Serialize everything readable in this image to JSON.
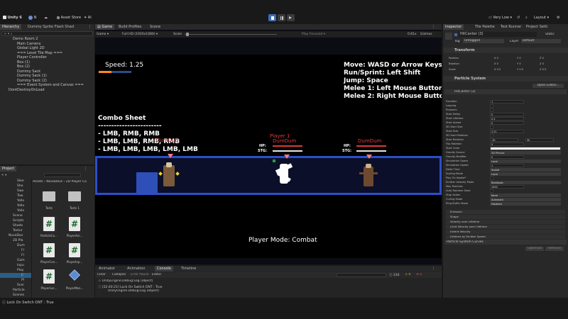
{
  "colors": {
    "accent": "#3d6db5",
    "hp_bar": "#d83a3a",
    "stg_bar": "#e8e8e8",
    "enemy_name": "#e23b3b"
  },
  "toolbar": {
    "unity_label": "Unity 6",
    "account": "N",
    "asset_store": "Asset Store",
    "ai": "AI",
    "quality": "Very Low",
    "layout": "Layout"
  },
  "tabs": {
    "hierarchy": "Hierarchy",
    "dummy": "Dummy Sprite Flash Shad",
    "game": "Game",
    "build_profiles": "Build Profiles",
    "scene": "Scene",
    "inspector": "Inspector",
    "tile_palette": "Tile Palette",
    "test_runner": "Test Runner",
    "project_settings": "Project Setti"
  },
  "hierarchy": {
    "items": [
      "Demo Room 2",
      "Main Camera",
      "Global Light 2D",
      "=== Level Tile Map ===",
      "Player Controller",
      "Box (1)",
      "Box (2)",
      "Dummy Sack",
      "Dummy Sack (1)",
      "Dummy Sack (2)",
      "=== Event System and Canvas ===",
      "DontDestroyOnLoad"
    ]
  },
  "project": {
    "tab": "Project",
    "breadcrumb": [
      "Assets",
      "NovaDevs",
      "2D Player Co"
    ],
    "tree": [
      "Slee",
      "Sho",
      "Swo",
      "Tow",
      "Yello",
      "Yello",
      "Yello",
      "Scene",
      "Scripts",
      "Shade",
      "Textur",
      "NovaDev",
      "2D Pla",
      "Dum",
      "Fl",
      "Fl",
      "Gam",
      "Inpu",
      "Play",
      "C",
      "Pl",
      "Scer",
      "Particle",
      "Scenes"
    ],
    "assets": [
      {
        "name": "Tests",
        "type": "folder"
      },
      {
        "name": "Tests 1",
        "type": "folder"
      },
      {
        "name": "ParticleCo...",
        "type": "script"
      },
      {
        "name": "PlayerAni...",
        "type": "script"
      },
      {
        "name": "PlayerCon...",
        "type": "script"
      },
      {
        "name": "PlayerInp...",
        "type": "script"
      },
      {
        "name": "PlayerLoc...",
        "type": "script"
      },
      {
        "name": "PlayerMan...",
        "type": "prefab"
      }
    ]
  },
  "game": {
    "display": "Game",
    "resolution": "Full HD (1920x1080)",
    "scale_label": "Scale",
    "scale_value": "0.61x",
    "play_focused": "Play Focused",
    "gizmos": "Gizmos",
    "speed": "Speed: 1.25",
    "controls": [
      "Move: WASD or Arrow Keys",
      "Run/Sprint: Left Shift",
      "Jump: Space",
      "Melee 1: Left Mouse Button",
      "Melee 2: Right Mouse Button"
    ],
    "combo_title": "Combo Sheet",
    "combo_divider": "------------------------",
    "combos": [
      "- LMB, RMB, RMB",
      "- LMB, LMB, RMB, RMB",
      "- LMB, LMB, LMB, LMB, LMB"
    ],
    "player_label": "Player 1",
    "dummy_name": "DumDum",
    "hp_label": "HP:",
    "stg_label": "STG:",
    "mode": "Player Mode: Combat"
  },
  "console": {
    "tabs": [
      "Animator",
      "Animation",
      "Console",
      "Timeline"
    ],
    "toolbar": [
      "Clear",
      "Collapse",
      "Error Pause",
      "Editor"
    ],
    "count_log": "234",
    "count_warn": "0",
    "count_err": "0",
    "lines": [
      "UnityEngine.Debug:Log (object)",
      "[22:40:21] Lock On Switch ONT : True",
      "UnityEngine.Debug:Log (object)"
    ]
  },
  "status": {
    "message": "Lock On Switch ONT : True"
  },
  "inspector": {
    "object_name": "HitCanter (3)",
    "static": "Static",
    "tag_label": "Tag",
    "tag_value": "Untagged",
    "layer_label": "Layer",
    "layer_value": "Default",
    "transform": "Transform",
    "position": {
      "label": "Position",
      "x": "0",
      "y": "0",
      "z": "0"
    },
    "rotation": {
      "label": "Rotation",
      "x": "0",
      "y": "0",
      "z": "0"
    },
    "scale": {
      "label": "Scale",
      "x": "0.5",
      "y": "0.5",
      "z": "0.5"
    },
    "particle_system": "Particle System",
    "open_editor": "Open Editor...",
    "ps_name": "HitCanter (3)",
    "props": [
      {
        "label": "Duration",
        "value": "1"
      },
      {
        "label": "Looping",
        "value": ""
      },
      {
        "label": "Prewarm",
        "value": ""
      },
      {
        "label": "Start Delay",
        "value": "0"
      },
      {
        "label": "Start Lifetime",
        "value": "0.3"
      },
      {
        "label": "Start Speed",
        "value": "0"
      },
      {
        "label": "3D Start Size",
        "value": ""
      },
      {
        "label": "Start Size",
        "value": "2.21"
      },
      {
        "label": "3D Start Rotation",
        "value": ""
      },
      {
        "label": "Start Rotation",
        "value": "-30"
      },
      {
        "label": "Flip Rotation",
        "value": "0"
      },
      {
        "label": "Start Color",
        "value": ""
      },
      {
        "label": "Gravity Source",
        "value": "2D Physics"
      },
      {
        "label": "Gravity Modifier",
        "value": "0"
      },
      {
        "label": "Simulation Space",
        "value": "Local"
      },
      {
        "label": "Simulation Speed",
        "value": "1"
      },
      {
        "label": "Delta Time",
        "value": "Scaled"
      },
      {
        "label": "Scaling Mode",
        "value": "Local"
      },
      {
        "label": "Play On Awake*",
        "value": ""
      },
      {
        "label": "Emitter Velocity Mode",
        "value": "Rigidbody"
      },
      {
        "label": "Max Particles",
        "value": "1000"
      },
      {
        "label": "Auto Random Seed",
        "value": ""
      },
      {
        "label": "Stop Action",
        "value": "None"
      },
      {
        "label": "Culling Mode",
        "value": "Automatic"
      },
      {
        "label": "Ring Buffer Mode",
        "value": "Disabled"
      }
    ],
    "rotation_extra": "30",
    "modules": [
      "Emission",
      "Shape",
      "Velocity over Lifetime",
      "Limit Velocity over Lifetime",
      "Inherit Velocity",
      "Lifetime by Emitter Speed"
    ],
    "curves": "Particle System Curves",
    "optimize": "Optimize",
    "remove": "Remove"
  }
}
